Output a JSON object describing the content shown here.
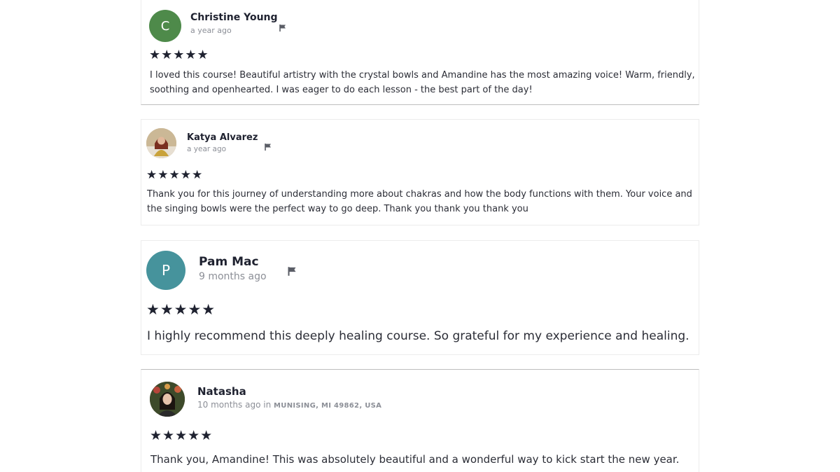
{
  "reviews": [
    {
      "name": "Christine Young",
      "time": "a year ago",
      "avatar_letter": "C",
      "avatar_color": "#4e8a4a",
      "rating": 5,
      "stars": "★★★★★",
      "text": "I loved this course! Beautiful artistry with the crystal bowls and Amandine has the most amazing voice! Warm, friendly, soothing and openhearted. I was eager to do each lesson - the best part of the day!"
    },
    {
      "name": "Katya Alvarez",
      "time": "a year ago",
      "avatar_icon": "user-photo-avatar",
      "rating": 5,
      "stars": "★★★★★",
      "text": "Thank you for this journey of understanding more about chakras and how the body functions with them. Your voice and the singing bowls were the perfect way to go deep. Thank you thank you thank you"
    },
    {
      "name": "Pam Mac",
      "time": "9 months ago",
      "avatar_letter": "P",
      "avatar_color": "#46939c",
      "rating": 5,
      "stars": "★★★★★",
      "text": "I highly recommend this deeply healing course. So grateful for my experience and healing."
    },
    {
      "name": "Natasha",
      "time": "10 months ago",
      "time_in": "in",
      "location": "MUNISING, MI 49862, USA",
      "avatar_icon": "user-photo-avatar",
      "rating": 5,
      "stars": "★★★★★",
      "text": "Thank you, Amandine! This was absolutely beautiful and a wonderful way to kick start the new year."
    }
  ],
  "flag_icon": "flag-icon"
}
